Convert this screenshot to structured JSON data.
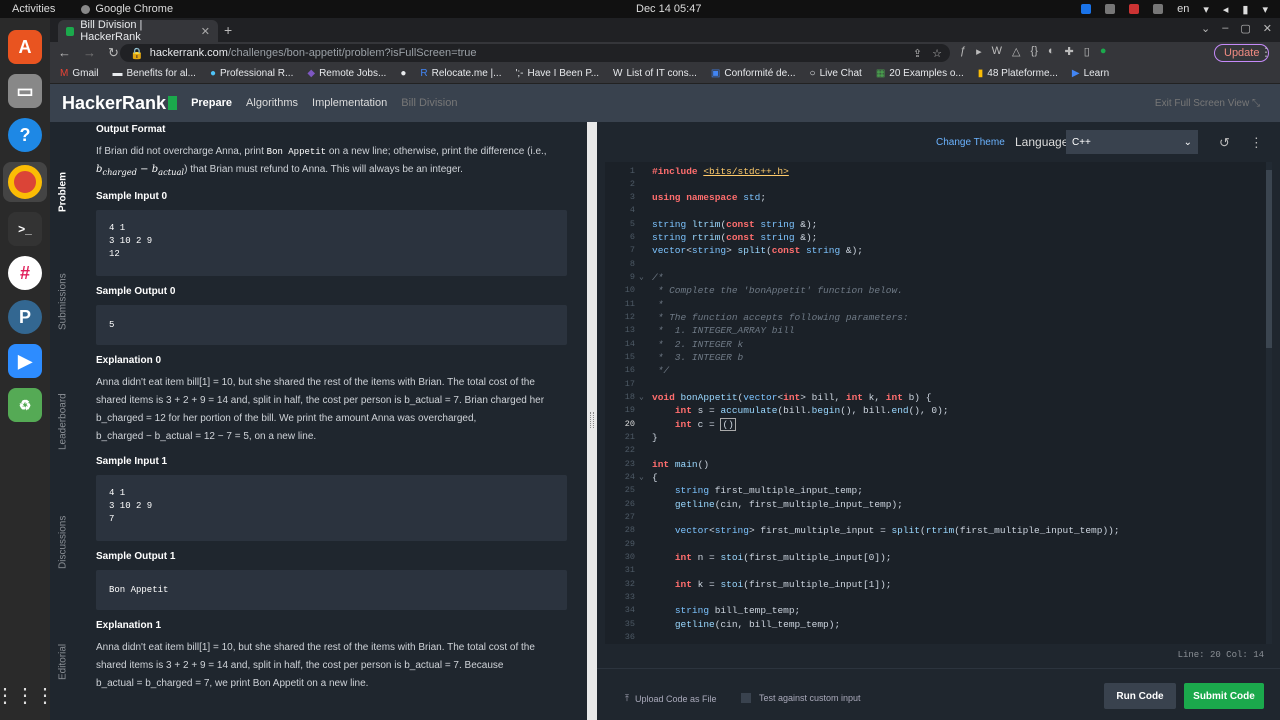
{
  "os": {
    "activities": "Activities",
    "app_name": "Google Chrome",
    "clock": "Dec 14  05:47",
    "keyboard_lang": "en"
  },
  "browser": {
    "tab_title": "Bill Division | HackerRank",
    "url_host": "hackerrank.com",
    "url_path": "/challenges/bon-appetit/problem?isFullScreen=true",
    "update_label": "Update",
    "bookmarks": [
      "Gmail",
      "Benefits for al...",
      "Professional R...",
      "Remote Jobs...",
      "Relocate.me |...",
      "Have I Been P...",
      "List of IT cons...",
      "Conformité de...",
      "Live Chat",
      "20 Examples o...",
      "48 Plateforme...",
      "Learn"
    ]
  },
  "hr": {
    "logo": "HackerRank",
    "crumbs": [
      "Prepare",
      "Algorithms",
      "Implementation",
      "Bill Division"
    ],
    "exit_fullscreen": "Exit Full Screen View",
    "side_tabs": [
      "Problem",
      "Submissions",
      "Leaderboard",
      "Discussions",
      "Editorial"
    ]
  },
  "problem": {
    "output_format_h": "Output Format",
    "output_format_p1": "If Brian did not overcharge Anna, print",
    "output_format_code": "Bon Appetit",
    "output_format_p2": "on a new line; otherwise, print the difference (i.e.,",
    "output_format_math": "b",
    "output_format_p3": "that Brian must refund to Anna. This will always be an integer.",
    "sample_input0_h": "Sample Input 0",
    "sample_input0": "4 1\n3 10 2 9\n12",
    "sample_output0_h": "Sample Output 0",
    "sample_output0": "5",
    "explanation0_h": "Explanation 0",
    "explanation0_l1": "Anna didn't eat item bill[1] = 10, but she shared the rest of the items with Brian. The total cost of the",
    "explanation0_l2": "shared items is 3 + 2 + 9 = 14 and, split in half, the cost per person is b_actual = 7. Brian charged her",
    "explanation0_l3": "b_charged = 12 for her portion of the bill. We print the amount Anna was overcharged,",
    "explanation0_l4": "b_charged − b_actual = 12 − 7 = 5, on a new line.",
    "sample_input1_h": "Sample Input 1",
    "sample_input1": "4 1\n3 10 2 9\n7",
    "sample_output1_h": "Sample Output 1",
    "sample_output1": "Bon Appetit",
    "explanation1_h": "Explanation 1",
    "explanation1_l1": "Anna didn't eat item bill[1] = 10, but she shared the rest of the items with Brian. The total cost of the",
    "explanation1_l2": "shared items is 3 + 2 + 9 = 14 and, split in half, the cost per person is b_actual = 7. Because",
    "explanation1_l3": "b_actual = b_charged = 7, we print Bon Appetit on a new line."
  },
  "editor": {
    "change_theme": "Change Theme",
    "language_label": "Language",
    "language_value": "C++",
    "status": "Line: 20 Col: 14",
    "upload_label": "Upload Code as File",
    "custom_input_label": "Test against custom input",
    "run_label": "Run Code",
    "submit_label": "Submit Code",
    "current_line": 20
  }
}
